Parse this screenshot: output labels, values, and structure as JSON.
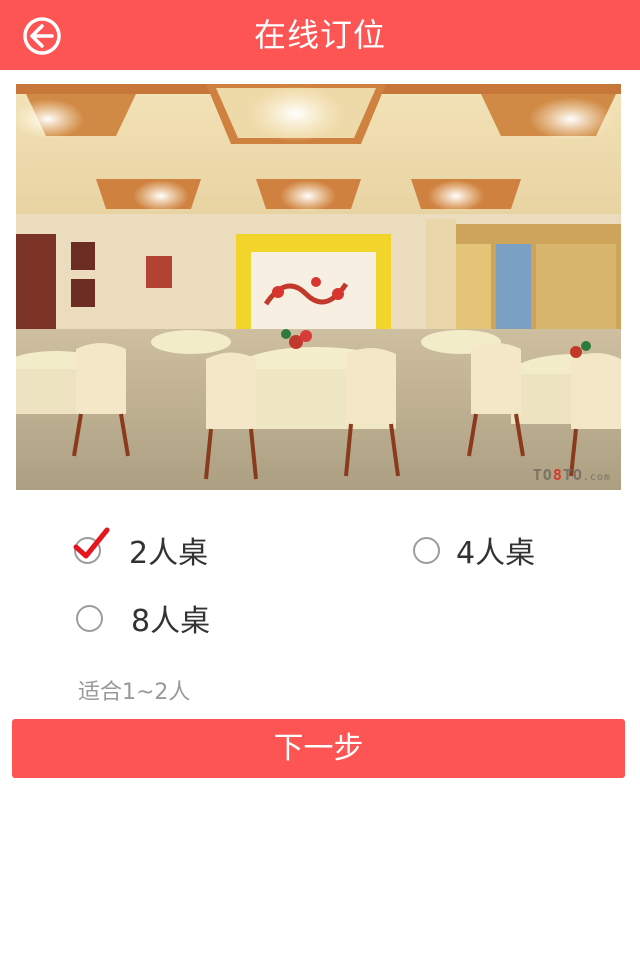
{
  "header": {
    "title": "在线订位",
    "back_icon": "arrow-left-circle-icon",
    "bg_color": "#fd5454"
  },
  "banner": {
    "watermark": {
      "prefix": "TO",
      "highlight": "8",
      "suffix": "TO",
      "domain": ".com"
    }
  },
  "table_options": [
    {
      "label": "2人桌",
      "selected": true
    },
    {
      "label": "4人桌",
      "selected": false
    },
    {
      "label": "8人桌",
      "selected": false
    }
  ],
  "hint": "适合1~2人",
  "next_button": {
    "label": "下一步",
    "color": "#fd5454"
  },
  "colors": {
    "accent": "#fd5454",
    "check": "#e8141c",
    "radio_border": "#9c9c9c"
  }
}
